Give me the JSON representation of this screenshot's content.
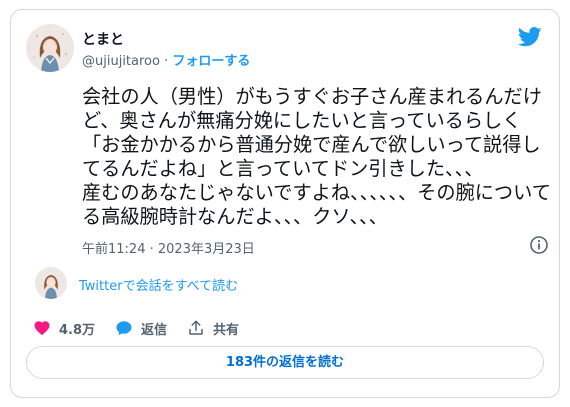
{
  "user": {
    "display_name": "とまと",
    "handle": "@ujiujitaroo",
    "separator": "·",
    "follow_label": "フォローする",
    "avatar_icon": "user-avatar"
  },
  "tweet": {
    "text": "会社の人（男性）がもうすぐお子さん産まれるんだけど、奥さんが無痛分娩にしたいと言っているらしく「お金かかるから普通分娩で産んで欲しいって説得してるんだよね」と言っていてドン引きした、、、\n産むのあなたじゃないですよね、、、、、、その腕についてる高級腕時計なんだよ、、、クソ、、、",
    "time": "午前11:24",
    "dot": "·",
    "date": "2023年3月23日"
  },
  "conversation": {
    "read_label": "Twitterで会話をすべて読む"
  },
  "actions": {
    "likes_count": "4.8万",
    "reply_label": "返信",
    "share_label": "共有"
  },
  "replies_button_label": "183件の返信を読む",
  "colors": {
    "brand": "#1d9bf0",
    "like": "#f91880",
    "text": "#0f1419",
    "secondary": "#536471",
    "border": "#cfd9de"
  }
}
